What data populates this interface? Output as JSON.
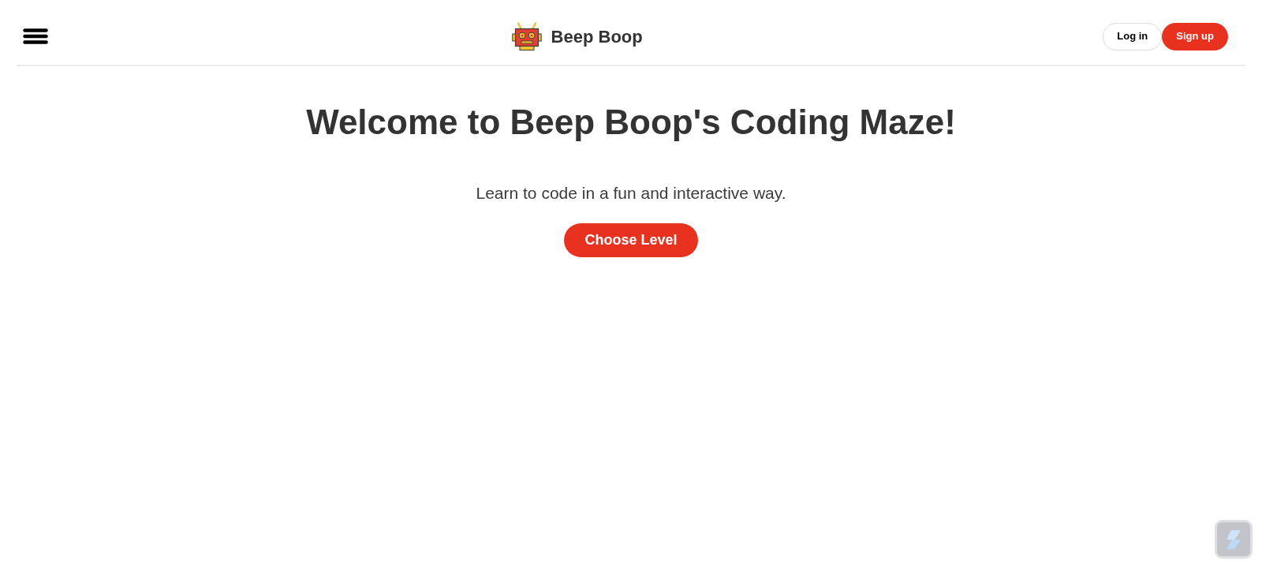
{
  "header": {
    "brand": "Beep Boop",
    "auth_buttons": [
      {
        "label": "Log in",
        "kind": "outline"
      },
      {
        "label": "Sign up",
        "kind": "filled"
      }
    ]
  },
  "hero": {
    "title": "Welcome to Beep Boop's Coding Maze!",
    "subtitle": "Learn to code in a fun and interactive way.",
    "cta": "Choose Level"
  }
}
